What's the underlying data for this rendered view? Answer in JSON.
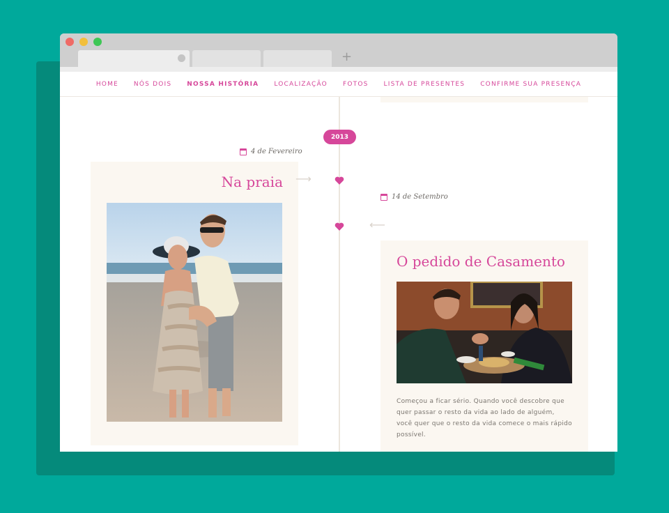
{
  "browser": {
    "tabs": [
      "",
      "",
      ""
    ],
    "new_tab": "+"
  },
  "nav": {
    "items": [
      {
        "label": "HOME"
      },
      {
        "label": "NÓS DOIS"
      },
      {
        "label": "NOSSA HISTÓRIA"
      },
      {
        "label": "LOCALIZAÇÃO"
      },
      {
        "label": "FOTOS"
      },
      {
        "label": "LISTA DE PRESENTES"
      },
      {
        "label": "CONFIRME SUA PRESENÇA"
      }
    ],
    "active_index": 2
  },
  "timeline": {
    "year": "2013",
    "events": [
      {
        "date": "4 de Fevereiro",
        "title": "Na praia",
        "side": "left"
      },
      {
        "date": "14 de Setembro",
        "title": "O pedido de Casamento",
        "side": "right",
        "description": "Começou a ficar sério. Quando você descobre que quer passar o resto da vida ao lado de alguém, você quer que o resto da vida comece o mais rápido possível."
      }
    ]
  },
  "colors": {
    "accent": "#d6479a",
    "background": "#00a99b",
    "card": "#fbf7f1"
  }
}
